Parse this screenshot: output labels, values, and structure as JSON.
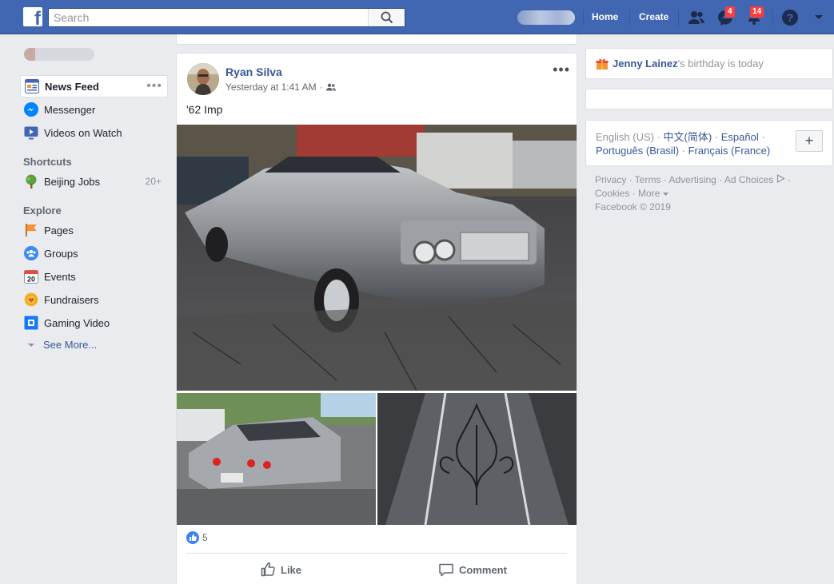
{
  "topbar": {
    "search_placeholder": "Search",
    "nav": {
      "home": "Home",
      "create": "Create"
    },
    "badges": {
      "messages": "4",
      "notifications": "14"
    }
  },
  "left_nav": {
    "items": [
      {
        "label": "News Feed",
        "icon": "news-feed-icon"
      },
      {
        "label": "Messenger",
        "icon": "messenger-icon"
      },
      {
        "label": "Videos on Watch",
        "icon": "watch-icon"
      }
    ],
    "shortcuts_heading": "Shortcuts",
    "shortcuts": [
      {
        "label": "Beijing Jobs",
        "count": "20+",
        "icon": "tree-icon"
      }
    ],
    "explore_heading": "Explore",
    "explore": [
      {
        "label": "Pages",
        "icon": "flag-icon"
      },
      {
        "label": "Groups",
        "icon": "groups-icon"
      },
      {
        "label": "Events",
        "icon": "calendar-icon",
        "icon_text": "20"
      },
      {
        "label": "Fundraisers",
        "icon": "fundraiser-icon"
      },
      {
        "label": "Gaming Video",
        "icon": "gaming-icon"
      }
    ],
    "see_more": "See More..."
  },
  "post": {
    "author": "Ryan Silva",
    "timestamp": "Yesterday at 1:41 AM",
    "separator": "·",
    "text": "'62 Imp",
    "reaction_count": "5",
    "actions": {
      "like": "Like",
      "comment": "Comment"
    }
  },
  "right": {
    "birthday": {
      "name": "Jenny Lainez",
      "suffix": "'s birthday is today"
    },
    "languages": {
      "current": "English (US)",
      "others": [
        "中文(简体)",
        "Español",
        "Português (Brasil)",
        "Français (France)"
      ]
    },
    "footer": {
      "links": [
        "Privacy",
        "Terms",
        "Advertising",
        "Ad Choices",
        "Cookies",
        "More"
      ],
      "copyright": "Facebook © 2019"
    }
  },
  "colors": {
    "brand": "#4267b2",
    "link": "#385898",
    "badge": "#fa3e3e",
    "background": "#e9ebee"
  }
}
